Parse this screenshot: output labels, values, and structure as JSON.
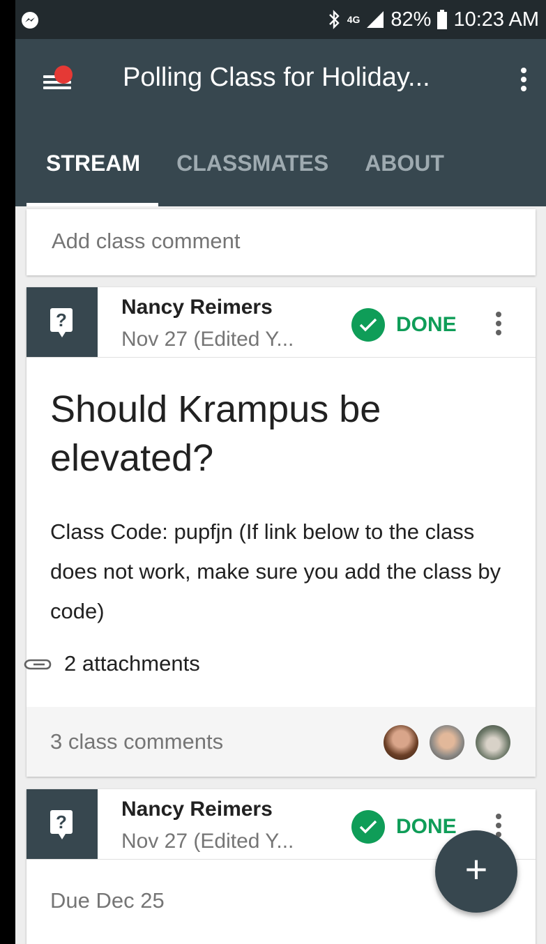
{
  "status_bar": {
    "network": "4G",
    "battery": "82%",
    "time": "10:23 AM"
  },
  "app_bar": {
    "title": "Polling Class for Holiday...",
    "tabs": [
      {
        "label": "STREAM",
        "active": true
      },
      {
        "label": "CLASSMATES",
        "active": false
      },
      {
        "label": "ABOUT",
        "active": false
      }
    ]
  },
  "comment_box": {
    "placeholder": "Add class comment"
  },
  "posts": [
    {
      "author": "Nancy Reimers",
      "date": "Nov 27 (Edited Y...",
      "status": "DONE",
      "title": "Should Krampus be elevated?",
      "description": "Class Code: pupfjn  (If link below to the class does not work, make sure you add the class by code)",
      "attachments": "2 attachments",
      "comments": "3 class comments"
    },
    {
      "author": "Nancy Reimers",
      "date": "Nov 27 (Edited Y...",
      "status": "DONE",
      "due": "Due Dec 25"
    }
  ],
  "colors": {
    "app_bar": "#37474f",
    "status_bar": "#222a2e",
    "done_green": "#0f9d58",
    "notification_dot": "#e53935"
  },
  "icons": {
    "messenger": "messenger-icon",
    "bluetooth": "bluetooth-icon",
    "signal": "signal-icon",
    "battery": "battery-icon",
    "menu": "menu-icon",
    "overflow": "more-vert-icon",
    "question": "question-icon",
    "check": "check-circle-icon",
    "attachment": "paperclip-icon",
    "add": "plus-icon"
  }
}
